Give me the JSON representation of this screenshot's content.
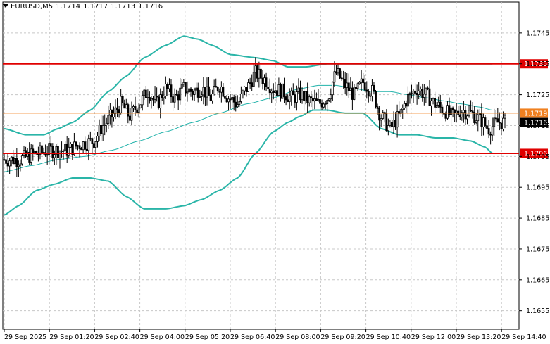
{
  "header": {
    "symbol": "EURUSD,M5",
    "open": "1.1714",
    "high": "1.1717",
    "low": "1.1713",
    "close": "1.1716"
  },
  "chart_data": {
    "type": "candlestick",
    "symbol": "EURUSD",
    "timeframe": "M5",
    "y_range": [
      1.1649,
      1.1755
    ],
    "y_ticks": [
      "1.1745",
      "1.1735",
      "1.1725",
      "1.1715",
      "1.1705",
      "1.1695",
      "1.1685",
      "1.1675",
      "1.1665",
      "1.1655"
    ],
    "x_ticks": [
      "29 Sep 2025",
      "29 Sep 01:20",
      "29 Sep 02:40",
      "29 Sep 04:00",
      "29 Sep 05:20",
      "29 Sep 06:40",
      "29 Sep 08:00",
      "29 Sep 09:20",
      "29 Sep 10:40",
      "29 Sep 12:00",
      "29 Sep 13:20",
      "29 Sep 14:40"
    ],
    "grid": true,
    "horizontal_levels": [
      {
        "label": "1.1735",
        "value": 1.1735,
        "color": "#e00000"
      },
      {
        "label": "1.1719",
        "value": 1.1719,
        "color": "#f08020"
      },
      {
        "label": "1.1706",
        "value": 1.1706,
        "color": "#e00000"
      }
    ],
    "current_price": {
      "label": "1.1716",
      "value": 1.1716
    },
    "close_path": [
      [
        0,
        1.1704
      ],
      [
        8,
        1.1704
      ],
      [
        18,
        1.1706
      ],
      [
        26,
        1.1707
      ],
      [
        35,
        1.1707
      ],
      [
        43,
        1.1709
      ],
      [
        50,
        1.171
      ],
      [
        55,
        1.1715
      ],
      [
        60,
        1.1718
      ],
      [
        65,
        1.1722
      ],
      [
        70,
        1.1718
      ],
      [
        75,
        1.1722
      ],
      [
        80,
        1.1726
      ],
      [
        85,
        1.1722
      ],
      [
        90,
        1.1727
      ],
      [
        95,
        1.1724
      ],
      [
        100,
        1.1727
      ],
      [
        105,
        1.1726
      ],
      [
        110,
        1.1727
      ],
      [
        115,
        1.1724
      ],
      [
        120,
        1.1728
      ],
      [
        125,
        1.1724
      ],
      [
        130,
        1.1722
      ],
      [
        135,
        1.1727
      ],
      [
        140,
        1.1732
      ],
      [
        145,
        1.173
      ],
      [
        150,
        1.1727
      ],
      [
        155,
        1.1726
      ],
      [
        160,
        1.1724
      ],
      [
        165,
        1.1725
      ],
      [
        170,
        1.1723
      ],
      [
        175,
        1.1722
      ],
      [
        180,
        1.1724
      ],
      [
        185,
        1.1732
      ],
      [
        190,
        1.1728
      ],
      [
        195,
        1.1725
      ],
      [
        200,
        1.1729
      ],
      [
        205,
        1.1726
      ],
      [
        210,
        1.1718
      ],
      [
        215,
        1.1714
      ],
      [
        220,
        1.1718
      ],
      [
        225,
        1.1724
      ],
      [
        230,
        1.1727
      ],
      [
        235,
        1.1725
      ],
      [
        240,
        1.1722
      ],
      [
        245,
        1.172
      ],
      [
        250,
        1.1718
      ],
      [
        255,
        1.172
      ],
      [
        260,
        1.1719
      ],
      [
        265,
        1.1717
      ],
      [
        270,
        1.1714
      ],
      [
        275,
        1.1716
      ],
      [
        279,
        1.1716
      ]
    ],
    "bollinger_upper": [
      [
        0,
        1.1714
      ],
      [
        12,
        1.1712
      ],
      [
        22,
        1.1712
      ],
      [
        30,
        1.1714
      ],
      [
        38,
        1.1716
      ],
      [
        48,
        1.172
      ],
      [
        58,
        1.1726
      ],
      [
        68,
        1.1731
      ],
      [
        78,
        1.1737
      ],
      [
        90,
        1.1741
      ],
      [
        100,
        1.1744
      ],
      [
        108,
        1.1743
      ],
      [
        116,
        1.1741
      ],
      [
        126,
        1.1738
      ],
      [
        140,
        1.1737
      ],
      [
        150,
        1.1736
      ],
      [
        158,
        1.1734
      ],
      [
        168,
        1.1734
      ],
      [
        180,
        1.1735
      ],
      [
        190,
        1.1735
      ],
      [
        200,
        1.1735
      ],
      [
        208,
        1.1735
      ],
      [
        215,
        1.1735
      ],
      [
        225,
        1.1735
      ],
      [
        238,
        1.1735
      ],
      [
        250,
        1.1735
      ],
      [
        258,
        1.1735
      ],
      [
        265,
        1.1735
      ],
      [
        272,
        1.1735
      ]
    ],
    "bollinger_middle": [
      [
        0,
        1.17
      ],
      [
        15,
        1.1702
      ],
      [
        30,
        1.1704
      ],
      [
        45,
        1.1705
      ],
      [
        60,
        1.1707
      ],
      [
        75,
        1.171
      ],
      [
        90,
        1.1713
      ],
      [
        105,
        1.1716
      ],
      [
        120,
        1.1719
      ],
      [
        135,
        1.1722
      ],
      [
        150,
        1.1724
      ],
      [
        165,
        1.1727
      ],
      [
        175,
        1.1728
      ],
      [
        185,
        1.1728
      ],
      [
        195,
        1.1727
      ],
      [
        205,
        1.1726
      ],
      [
        215,
        1.1726
      ],
      [
        225,
        1.1725
      ],
      [
        235,
        1.1724
      ],
      [
        245,
        1.1723
      ],
      [
        255,
        1.1722
      ],
      [
        265,
        1.1721
      ],
      [
        272,
        1.172
      ]
    ],
    "bollinger_lower": [
      [
        0,
        1.1686
      ],
      [
        8,
        1.1689
      ],
      [
        18,
        1.1694
      ],
      [
        28,
        1.1696
      ],
      [
        38,
        1.1698
      ],
      [
        48,
        1.1698
      ],
      [
        58,
        1.1697
      ],
      [
        68,
        1.1692
      ],
      [
        78,
        1.1688
      ],
      [
        90,
        1.1688
      ],
      [
        100,
        1.1689
      ],
      [
        110,
        1.1691
      ],
      [
        120,
        1.1694
      ],
      [
        130,
        1.1698
      ],
      [
        140,
        1.1706
      ],
      [
        150,
        1.1713
      ],
      [
        158,
        1.1716
      ],
      [
        165,
        1.1718
      ],
      [
        172,
        1.172
      ],
      [
        180,
        1.172
      ],
      [
        190,
        1.1719
      ],
      [
        200,
        1.1719
      ],
      [
        210,
        1.1714
      ],
      [
        220,
        1.1712
      ],
      [
        230,
        1.1712
      ],
      [
        240,
        1.1711
      ],
      [
        250,
        1.1711
      ],
      [
        260,
        1.171
      ],
      [
        268,
        1.1708
      ],
      [
        272,
        1.1706
      ]
    ]
  },
  "style": {
    "grid_color": "#c8c8c8",
    "candle_color": "#000000",
    "bollinger_color": "#20b2aa",
    "bollinger_outer_color": "#2ab5a8"
  }
}
